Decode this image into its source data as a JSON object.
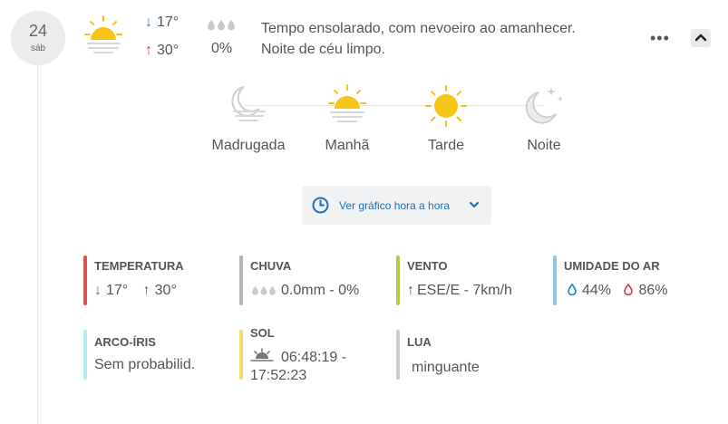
{
  "day": {
    "number": "24",
    "weekday": "sáb"
  },
  "summary": {
    "temp_min": "17°",
    "temp_max": "30°",
    "rain_pct": "0%",
    "description_line1": "Tempo ensolarado, com nevoeiro ao amanhecer.",
    "description_line2": "Noite de céu limpo."
  },
  "menu": {
    "more_label": "•••"
  },
  "periods": [
    {
      "label": "Madrugada",
      "icon": "moon-fog-icon"
    },
    {
      "label": "Manhã",
      "icon": "sun-fog-icon"
    },
    {
      "label": "Tarde",
      "icon": "sun-icon"
    },
    {
      "label": "Noite",
      "icon": "moon-stars-icon"
    }
  ],
  "hourly_button": {
    "label": "Ver gráfico hora a hora"
  },
  "stats": {
    "temperatura": {
      "title": "TEMPERATURA",
      "min": "17°",
      "max": "30°",
      "color": "#d9534f"
    },
    "chuva": {
      "title": "CHUVA",
      "value": "0.0mm - 0%",
      "color": "#b3b3b3"
    },
    "vento": {
      "title": "VENTO",
      "value": "ESE/E - 7km/h",
      "color": "#b5cc4a"
    },
    "umidade": {
      "title": "UMIDADE DO AR",
      "min": "44%",
      "max": "86%",
      "color": "#8ec3ea"
    },
    "arco_iris": {
      "title": "ARCO-ÍRIS",
      "value": "Sem probabilid.",
      "color": "#b5ebec"
    },
    "sol": {
      "title": "SOL",
      "sunrise": "06:48:19 -",
      "sunset": "17:52:23",
      "color": "#f7dc6f"
    },
    "lua": {
      "title": "LUA",
      "value": "minguante",
      "color": "#c8cdd0"
    }
  },
  "colors": {
    "accent_blue": "#1c7ec8",
    "accent_red": "#d33",
    "sun": "#f5c518"
  }
}
